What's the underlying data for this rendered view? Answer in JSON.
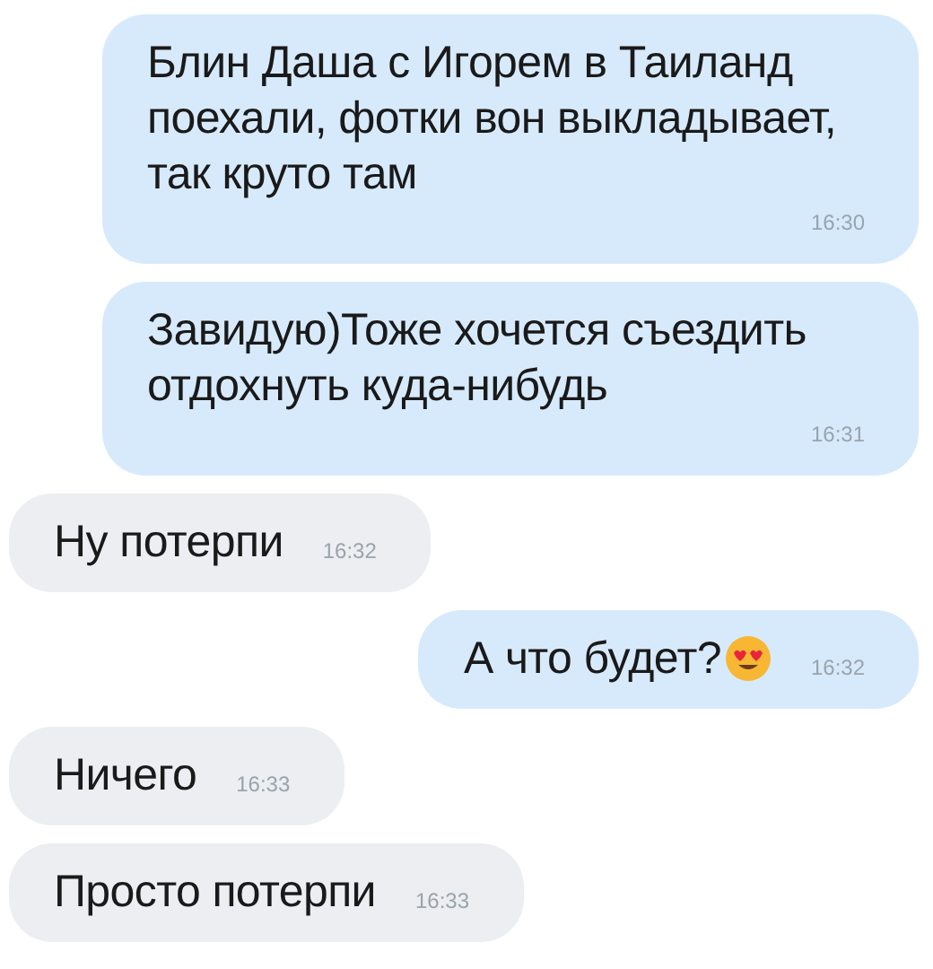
{
  "messages": [
    {
      "kind": "outgoing",
      "text": "Блин Даша с Игорем в Таиланд поехали, фотки вон выкладывает, так круто там",
      "time": "16:30"
    },
    {
      "kind": "outgoing",
      "text": "Завидую)Тоже хочется съездить отдохнуть куда-нибудь",
      "time": "16:31"
    },
    {
      "kind": "incoming",
      "text": "Ну потерпи",
      "time": "16:32"
    },
    {
      "kind": "outgoing",
      "text": "А что будет?",
      "time": "16:32",
      "emoji": true
    },
    {
      "kind": "incoming",
      "text": "Ничего",
      "time": "16:33"
    },
    {
      "kind": "incoming",
      "text": "Просто потерпи",
      "time": "16:33"
    }
  ]
}
